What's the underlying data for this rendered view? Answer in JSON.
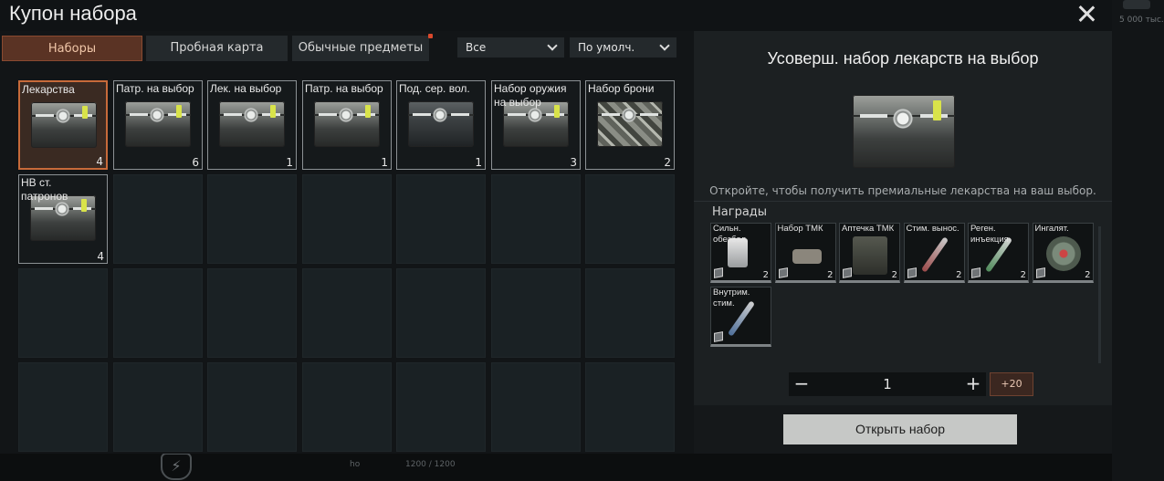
{
  "window": {
    "title": "Купон набора",
    "close_icon": "close-icon"
  },
  "background": {
    "money_text": "5 000 тыс.",
    "bottom_small_1": "ho",
    "bottom_small_2": "1200 / 1200"
  },
  "tabs": [
    {
      "label": "Наборы",
      "active": true,
      "badge": false
    },
    {
      "label": "Пробная карта",
      "active": false,
      "badge": false
    },
    {
      "label": "Обычные предметы",
      "active": false,
      "badge": true
    }
  ],
  "filters": {
    "category": "Все",
    "sort": "По умолч."
  },
  "inventory": [
    {
      "label": "Лекарства",
      "count": "4",
      "icon": "medicine-box-icon",
      "selected": true
    },
    {
      "label": "Патр. на выбор",
      "count": "6",
      "icon": "ammo-box-icon"
    },
    {
      "label": "Лек. на выбор",
      "count": "1",
      "icon": "medicine-box-icon"
    },
    {
      "label": "Патр. на выбор",
      "count": "1",
      "icon": "ammo-box-icon"
    },
    {
      "label": "Под. сер. вол.",
      "count": "1",
      "icon": "dark-box-icon"
    },
    {
      "label": "Набор оружия\nна выбор",
      "count": "3",
      "icon": "weapon-box-icon"
    },
    {
      "label": "Набор брони",
      "count": "2",
      "icon": "armor-box-icon"
    },
    {
      "label": "НВ ст.\nпатронов",
      "count": "4",
      "icon": "ammo-box-icon"
    }
  ],
  "detail": {
    "title": "Усоверш. набор лекарств на выбор",
    "description": "Откройте, чтобы получить премиальные лекарства на ваш выбор.",
    "rewards_label": "Награды",
    "rewards": [
      {
        "label": "Сильн.\nобезбол.",
        "count": "2",
        "icon": "painkiller-icon"
      },
      {
        "label": "Набор ТМК",
        "count": "2",
        "icon": "tourniquet-kit-icon"
      },
      {
        "label": "Аптечка ТМК",
        "count": "2",
        "icon": "first-aid-kit-icon"
      },
      {
        "label": "Стим. вынос.",
        "count": "2",
        "icon": "stamina-stim-icon"
      },
      {
        "label": "Реген.\nинъекция",
        "count": "2",
        "icon": "regen-injection-icon"
      },
      {
        "label": "Ингалят.",
        "count": "2",
        "icon": "inhaler-icon"
      },
      {
        "label": "Внутрим.\nстим.",
        "count": "",
        "icon": "intramuscular-stim-icon"
      }
    ],
    "quantity": "1",
    "quantity_boost": "+20",
    "open_button": "Открыть набор"
  },
  "colors": {
    "accent": "#c76a3a",
    "active_tab_bg": "#5a3324",
    "button_bg": "#c6c8c6",
    "modal_bg": "#181c1e"
  }
}
